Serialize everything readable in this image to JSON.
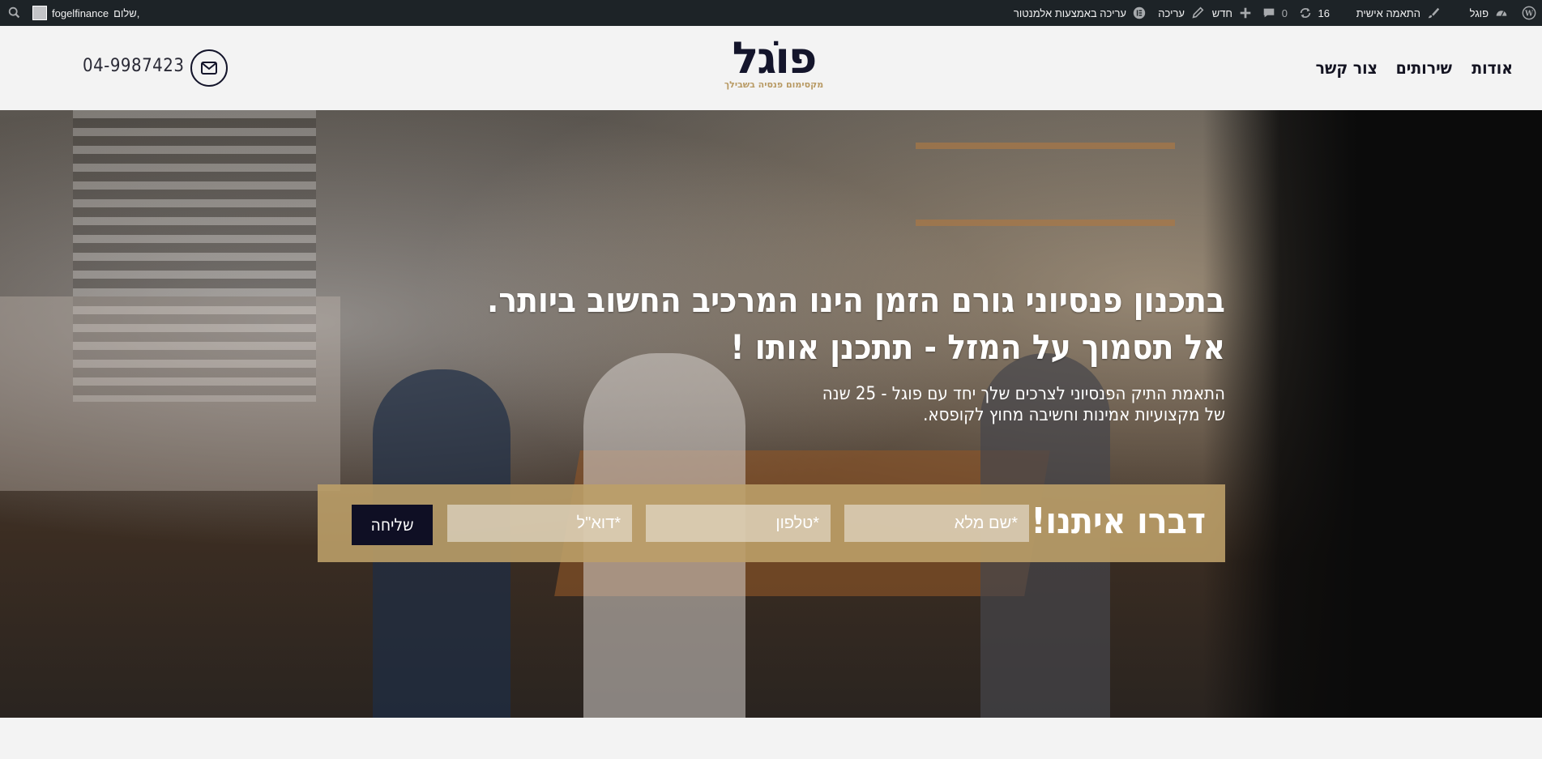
{
  "admin_bar": {
    "wp_logo_icon": "wordpress-icon",
    "site_name": "פוגל",
    "customize": "התאמה אישית",
    "updates_count": "16",
    "comments_count": "0",
    "new": "חדש",
    "edit": "עריכה",
    "edit_elementor": "עריכה באמצעות אלמנטור",
    "greeting": "שלום,",
    "username": "fogelfinance"
  },
  "header": {
    "nav": [
      "אודות",
      "שירותים",
      "צור קשר"
    ],
    "logo_word": "פוֹגל",
    "logo_tagline": "מקסימום פנסיה בשבילך",
    "phone": "04-9987423"
  },
  "hero": {
    "headline_line1": "בתכנון פנסיוני גורם הזמן הינו המרכיב החשוב ביותר.",
    "headline_line2": "אל תסמוך על המזל - תתכנן אותו !",
    "sub_line1": "התאמת התיק הפנסיוני לצרכים שלך יחד עם פוגל - 25 שנה",
    "sub_line2": "של מקצועיות אמינות וחשיבה מחוץ לקופסא."
  },
  "form": {
    "title": "דברו איתנו!",
    "name_placeholder": "*שם מלא",
    "phone_placeholder": "*טלפון",
    "email_placeholder": "*דוא\"ל",
    "submit_label": "שליחה"
  },
  "colors": {
    "brand_navy": "#14152b",
    "brand_gold": "#bb9e68",
    "admin_bar": "#1d2327"
  }
}
